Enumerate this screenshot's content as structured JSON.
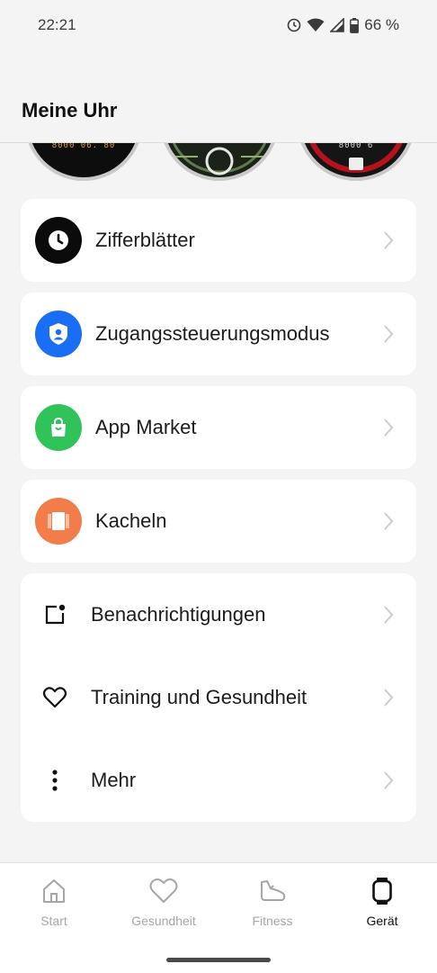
{
  "status": {
    "time": "22:21",
    "battery": "66 %"
  },
  "header": {
    "title": "Meine Uhr"
  },
  "watch_faces": [
    {
      "text": "8000  06.  80"
    },
    {
      "text": ""
    },
    {
      "text": "8000  6"
    }
  ],
  "menu": {
    "watch_faces": "Zifferblätter",
    "access_mode": "Zugangssteuerungsmodus",
    "app_market": "App Market",
    "tiles": "Kacheln",
    "notifications": "Benachrichtigungen",
    "training": "Training und Gesundheit",
    "more": "Mehr"
  },
  "nav": {
    "start": "Start",
    "health": "Gesundheit",
    "fitness": "Fitness",
    "device": "Gerät"
  },
  "colors": {
    "shield_blue": "#1a6ef5",
    "market_green": "#2fc35a",
    "tiles_orange": "#f27d4a"
  }
}
